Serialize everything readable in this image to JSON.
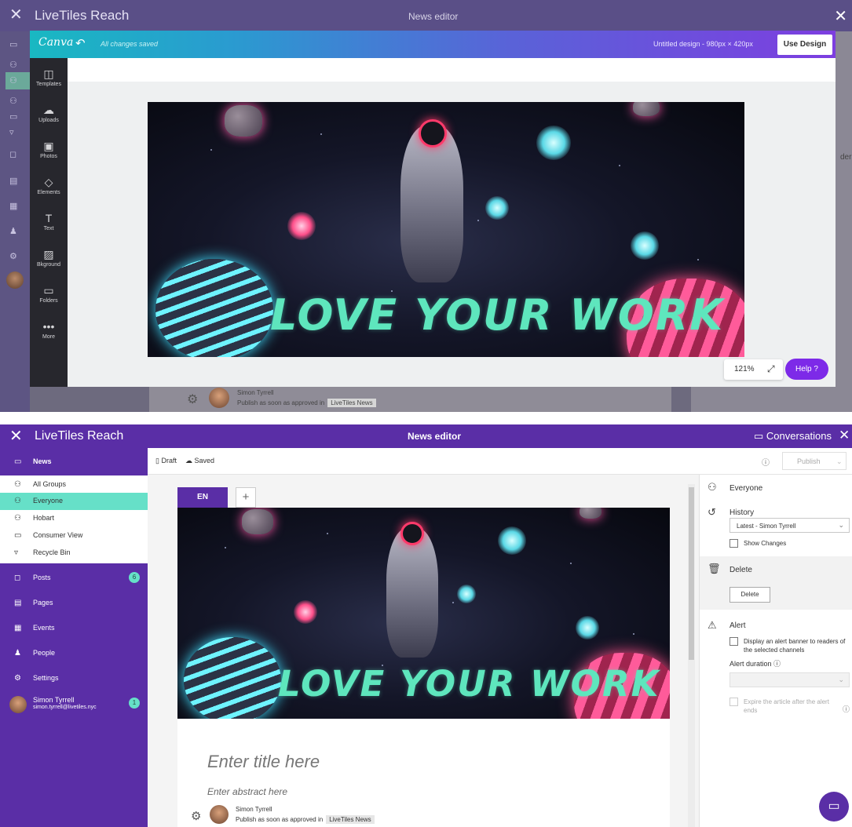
{
  "top": {
    "header": {
      "app_title": "LiveTiles Reach",
      "center_title": "News editor"
    },
    "canva": {
      "brand": "Canva",
      "save_status": "All changes saved",
      "design_info": "Untitled design - 980px × 420px",
      "use_design_label": "Use Design",
      "sidebar": [
        {
          "label": "Templates",
          "icon": "templates-icon",
          "glyph": "◫"
        },
        {
          "label": "Uploads",
          "icon": "upload-cloud-icon",
          "glyph": "☁"
        },
        {
          "label": "Photos",
          "icon": "photos-icon",
          "glyph": "▣"
        },
        {
          "label": "Elements",
          "icon": "elements-icon",
          "glyph": "◇"
        },
        {
          "label": "Text",
          "icon": "text-icon",
          "glyph": "T"
        },
        {
          "label": "Bkground",
          "icon": "background-icon",
          "glyph": "▨"
        },
        {
          "label": "Folders",
          "icon": "folder-icon",
          "glyph": "▭"
        },
        {
          "label": "More",
          "icon": "more-icon",
          "glyph": "•••"
        }
      ],
      "zoom": "121%",
      "help_label": "Help ?"
    },
    "banner_text": "LOVE YOUR WORK",
    "byline": {
      "name": "Simon Tyrrell",
      "publish_text": "Publish as soon as approved in",
      "channel": "LiveTiles News"
    },
    "right_partial": "ders"
  },
  "bottom": {
    "header": {
      "app_title": "LiveTiles Reach",
      "center_title": "News editor",
      "conversations": "Conversations"
    },
    "nav": {
      "news_label": "News",
      "groups": [
        "All Groups",
        "Everyone",
        "Hobart",
        "Consumer View",
        "Recycle Bin"
      ],
      "selected_group": "Everyone",
      "items": [
        {
          "label": "Posts",
          "icon": "posts-icon",
          "badge": "6"
        },
        {
          "label": "Pages",
          "icon": "pages-icon"
        },
        {
          "label": "Events",
          "icon": "events-icon"
        },
        {
          "label": "People",
          "icon": "people-icon"
        },
        {
          "label": "Settings",
          "icon": "settings-icon"
        }
      ],
      "user": {
        "name": "Simon Tyrrell",
        "email": "simon.tyrrell@livetiles.nyc",
        "badge": "1"
      }
    },
    "toolbar": {
      "draft_label": "Draft",
      "saved_label": "Saved",
      "publish_label": "Publish"
    },
    "editor": {
      "language_tab": "EN",
      "add_tab": "+",
      "banner_text": "LOVE YOUR WORK",
      "title_placeholder": "Enter title here",
      "abstract_placeholder": "Enter abstract here",
      "byline": {
        "name": "Simon Tyrrell",
        "publish_text": "Publish as soon as approved in",
        "channel": "LiveTiles News"
      }
    },
    "right_panel": {
      "audience": "Everyone",
      "history_label": "History",
      "history_value": "Latest - Simon Tyrrell",
      "show_changes": "Show Changes",
      "delete_label": "Delete",
      "delete_button": "Delete",
      "alert_label": "Alert",
      "alert_banner_text": "Display an alert banner to readers of the selected channels",
      "alert_duration_label": "Alert duration",
      "expire_text": "Expire the article after the alert ends"
    }
  },
  "colors": {
    "reach_purple": "#5a2ea6",
    "accent_teal": "#66e0c8",
    "canva_purple": "#7d2ae8"
  }
}
